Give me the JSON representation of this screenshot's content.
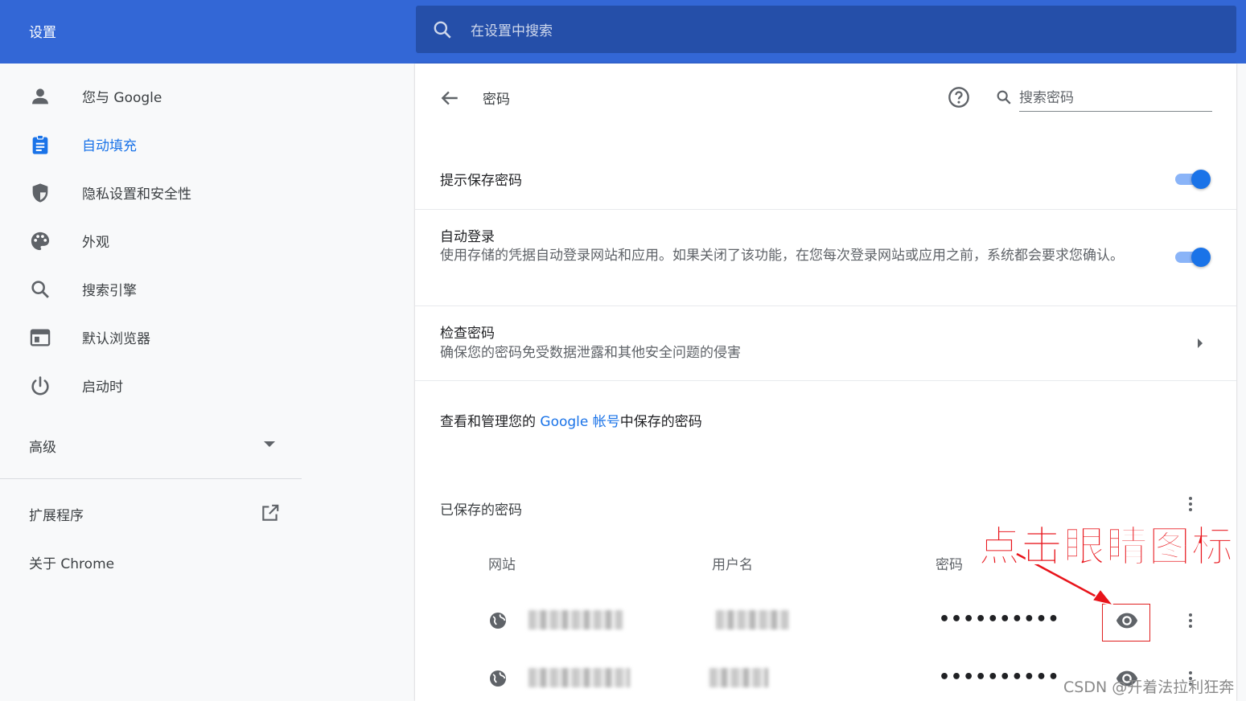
{
  "header": {
    "title": "设置",
    "search_placeholder": "在设置中搜索"
  },
  "sidebar": {
    "items": [
      {
        "label": "您与 Google",
        "icon": "person-icon"
      },
      {
        "label": "自动填充",
        "icon": "clipboard-icon",
        "active": true
      },
      {
        "label": "隐私设置和安全性",
        "icon": "shield-icon"
      },
      {
        "label": "外观",
        "icon": "palette-icon"
      },
      {
        "label": "搜索引擎",
        "icon": "search-icon"
      },
      {
        "label": "默认浏览器",
        "icon": "browser-window-icon"
      },
      {
        "label": "启动时",
        "icon": "power-icon"
      }
    ],
    "advanced_label": "高级",
    "extensions_label": "扩展程序",
    "about_label": "关于 Chrome"
  },
  "page": {
    "title": "密码",
    "search_placeholder": "搜索密码",
    "offer_save": {
      "title": "提示保存密码",
      "enabled": true
    },
    "auto_signin": {
      "title": "自动登录",
      "description": "使用存储的凭据自动登录网站和应用。如果关闭了该功能，在您每次登录网站或应用之前，系统都会要求您确认。",
      "enabled": true
    },
    "check_passwords": {
      "title": "检查密码",
      "description": "确保您的密码免受数据泄露和其他安全问题的侵害"
    },
    "manage": {
      "prefix": "查看和管理您的 ",
      "link": "Google 帐号",
      "suffix": "中保存的密码"
    },
    "saved": {
      "title": "已保存的密码",
      "columns": [
        "网站",
        "用户名",
        "密码"
      ],
      "rows": [
        {
          "password": "••••••••••"
        },
        {
          "password": "••••••••••"
        }
      ]
    }
  },
  "annotation": {
    "text": "点击眼睛图标",
    "color": "#e8141b"
  },
  "watermark": "CSDN @开着法拉利狂奔",
  "colors": {
    "header_blue": "#3367d6",
    "search_blue": "#254fa9",
    "accent": "#1a73e8"
  }
}
